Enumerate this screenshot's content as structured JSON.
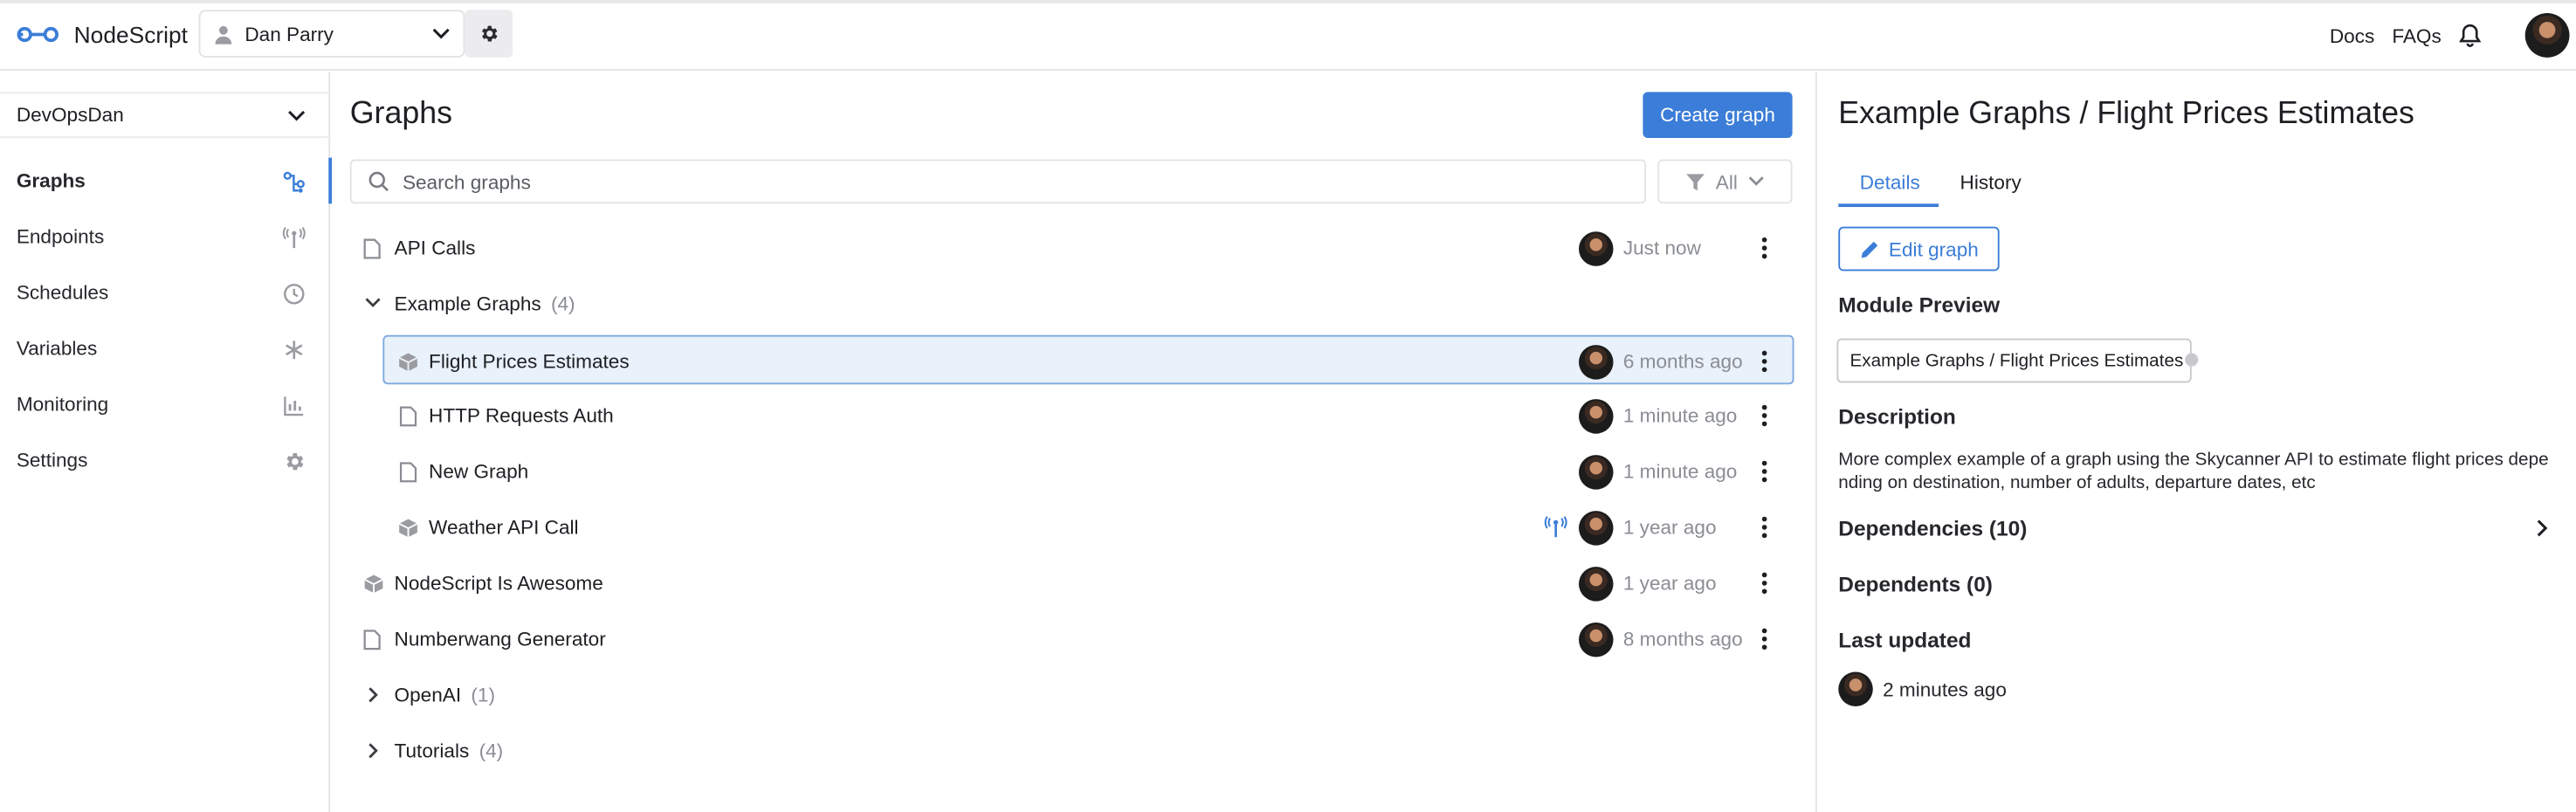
{
  "app": {
    "name": "NodeScript"
  },
  "topbar": {
    "user": "Dan Parry",
    "links": [
      "Docs",
      "FAQs"
    ]
  },
  "sidebar": {
    "org": "DevOpsDan",
    "items": [
      {
        "label": "Graphs",
        "icon": "graph-icon",
        "active": true
      },
      {
        "label": "Endpoints",
        "icon": "endpoint-icon"
      },
      {
        "label": "Schedules",
        "icon": "clock-icon"
      },
      {
        "label": "Variables",
        "icon": "asterisk-icon"
      },
      {
        "label": "Monitoring",
        "icon": "bar-chart-icon"
      },
      {
        "label": "Settings",
        "icon": "gear-icon"
      }
    ]
  },
  "main": {
    "title": "Graphs",
    "create_button": "Create graph",
    "search_placeholder": "Search graphs",
    "filter_label": "All",
    "rows": [
      {
        "name": "API Calls",
        "type": "file",
        "time": "Just now"
      },
      {
        "name": "Example Graphs",
        "type": "folder-open",
        "count": "(4)"
      },
      {
        "name": "Flight Prices Estimates",
        "type": "module",
        "time": "6 months ago",
        "selected": true
      },
      {
        "name": "HTTP Requests Auth",
        "type": "file",
        "time": "1 minute ago"
      },
      {
        "name": "New Graph",
        "type": "file",
        "time": "1 minute ago"
      },
      {
        "name": "Weather API Call",
        "type": "module",
        "time": "1 year ago",
        "endpoint": true
      },
      {
        "name": "NodeScript Is Awesome",
        "type": "module",
        "time": "1 year ago"
      },
      {
        "name": "Numberwang Generator",
        "type": "file",
        "time": "8 months ago"
      },
      {
        "name": "OpenAI",
        "type": "folder-closed",
        "count": "(1)"
      },
      {
        "name": "Tutorials",
        "type": "folder-closed",
        "count": "(4)"
      }
    ]
  },
  "detail": {
    "title": "Example Graphs / Flight Prices Estimates",
    "tabs": [
      "Details",
      "History"
    ],
    "edit_button": "Edit graph",
    "module_preview_heading": "Module Preview",
    "module_preview_label": "Example Graphs / Flight Prices Estimates",
    "description_heading": "Description",
    "description": "More complex example of a graph using the Skycanner API to estimate flight prices depending on destination, number of adults, departure dates, etc",
    "dependencies": "Dependencies (10)",
    "dependents": "Dependents (0)",
    "last_updated_heading": "Last updated",
    "last_updated": "2 minutes ago"
  },
  "colors": {
    "accent": "#3b7dd8",
    "selected_bg": "#e9f1fa",
    "muted": "#8a8d93"
  }
}
